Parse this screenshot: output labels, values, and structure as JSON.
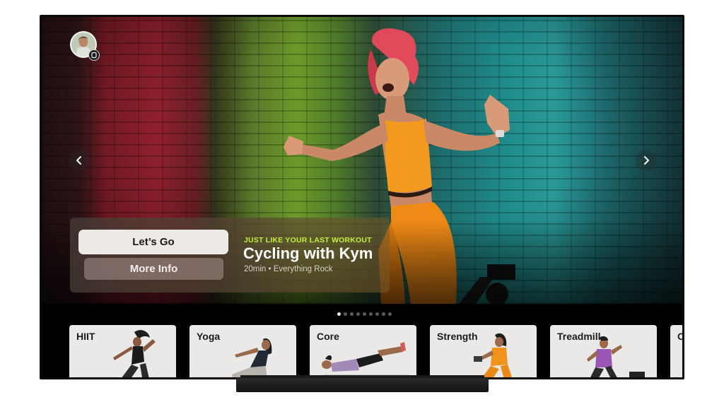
{
  "hero": {
    "eyebrow": "JUST LIKE YOUR LAST WORKOUT",
    "title": "Cycling with Kym",
    "subtitle": "20min • Everything Rock",
    "primary_button": "Let’s Go",
    "secondary_button": "More Info",
    "accent_color": "#c5ec3c"
  },
  "navigation": {
    "prev_icon": "chevron-left-icon",
    "next_icon": "chevron-right-icon"
  },
  "profile": {
    "avatar_icon": "user-avatar",
    "badge_icon": "watch-icon"
  },
  "pager": {
    "page_count": 9,
    "active_index": 0
  },
  "categories": [
    {
      "label": "HIIT"
    },
    {
      "label": "Yoga"
    },
    {
      "label": "Core"
    },
    {
      "label": "Strength"
    },
    {
      "label": "Treadmill"
    },
    {
      "label": "C"
    }
  ]
}
